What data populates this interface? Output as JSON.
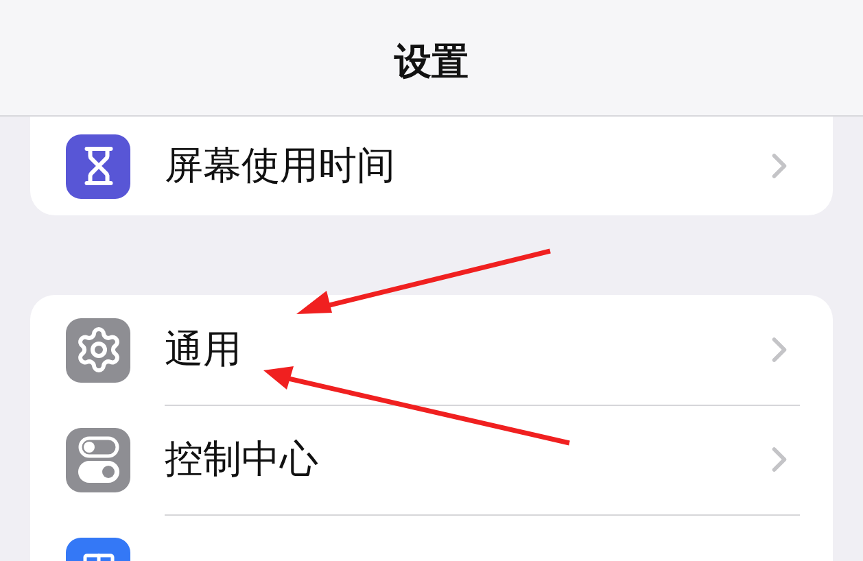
{
  "header": {
    "title": "设置"
  },
  "sections": [
    {
      "items": [
        {
          "label": "屏幕使用时间",
          "kind": "hourglass",
          "color": "#5856d6"
        }
      ]
    },
    {
      "items": [
        {
          "label": "通用",
          "kind": "gear",
          "color": "#8e8e93"
        },
        {
          "label": "控制中心",
          "kind": "toggles",
          "color": "#8e8e93"
        },
        {
          "kind": "display",
          "color": "#3478f6"
        }
      ]
    }
  ]
}
